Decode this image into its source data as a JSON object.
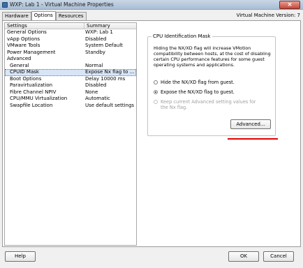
{
  "window": {
    "title": "WXP: Lab 1 - Virtual Machine Properties",
    "close_glyph": "×"
  },
  "tabs": [
    "Hardware",
    "Options",
    "Resources"
  ],
  "vm_version": "Virtual Machine Version: 7",
  "settings": {
    "headers": [
      "Settings",
      "Summary"
    ],
    "rows": [
      {
        "name": "General Options",
        "summary": "WXP: Lab 1"
      },
      {
        "name": "vApp Options",
        "summary": "Disabled"
      },
      {
        "name": "VMware Tools",
        "summary": "System Default"
      },
      {
        "name": "Power Management",
        "summary": "Standby"
      },
      {
        "name": "Advanced",
        "summary": ""
      },
      {
        "name": "General",
        "summary": "Normal"
      },
      {
        "name": "CPUID Mask",
        "summary": "Expose Nx flag to ..."
      },
      {
        "name": "Boot Options",
        "summary": "Delay 10000 ms"
      },
      {
        "name": "Paravirtualization",
        "summary": "Disabled"
      },
      {
        "name": "Fibre Channel NPIV",
        "summary": "None"
      },
      {
        "name": "CPU/MMU Virtualization",
        "summary": "Automatic"
      },
      {
        "name": "Swapfile Location",
        "summary": "Use default settings"
      }
    ]
  },
  "cpu_mask": {
    "group_title": "CPU Identification Mask",
    "description": "Hiding the NX/XD flag will increase VMotion compatibility between hosts, at the cost of disabling certain CPU performance features for some guest operating systems and applications.",
    "option_hide": "Hide the NX/XD flag from guest.",
    "option_expose": "Expose the NX/XD flag to guest.",
    "option_keep": "Keep current Advanced setting values for the Nx flag.",
    "selected": "expose",
    "advanced_label": "Advanced..."
  },
  "buttons": {
    "help": "Help",
    "ok": "OK",
    "cancel": "Cancel"
  },
  "colors": {
    "highlight_underline": "#e00000",
    "selection": "#d7e6f7"
  }
}
